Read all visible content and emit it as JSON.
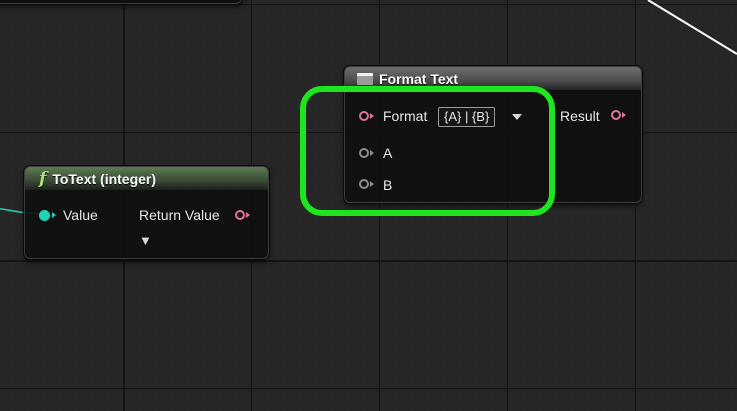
{
  "colors": {
    "text_pin": "#e0739c",
    "integer_pin": "#1fd3b4",
    "wildcard_pin": "#8b8b8b",
    "function_header": "#5d7b52",
    "highlight": "#1ee51e",
    "wire_integer": "#1fd3b4",
    "wire_exec": "#ffffff"
  },
  "totext_node": {
    "icon": "function-icon",
    "icon_glyph": "f",
    "title": "ToText (integer)",
    "input_label": "Value",
    "output_label": "Return Value",
    "advanced_glyph": "▼"
  },
  "format_node": {
    "icon": "format-node-icon",
    "title": "Format Text",
    "format_label": "Format",
    "format_value": "{A} | {B}",
    "arg_a_label": "A",
    "arg_b_label": "B",
    "result_label": "Result"
  }
}
